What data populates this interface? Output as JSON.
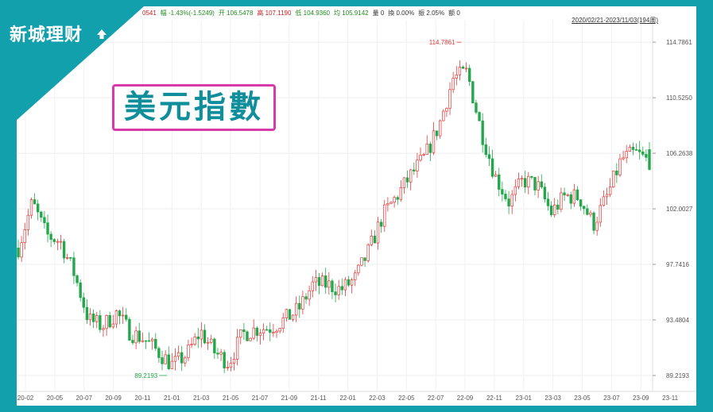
{
  "brand": {
    "name": "新城理财",
    "icon": "up-arrow-icon"
  },
  "title": "美元指數",
  "header": [
    {
      "text": "0541",
      "tone": "up"
    },
    {
      "text": "幅 -1.43%(-1.5249)",
      "tone": "dn"
    },
    {
      "text": "开 106.5478",
      "tone": "dn"
    },
    {
      "text": "高 107.1190",
      "tone": "up"
    },
    {
      "text": "低 104.9360",
      "tone": "dn"
    },
    {
      "text": "均 105.9142",
      "tone": "dn"
    },
    {
      "text": "量 0",
      "tone": ""
    },
    {
      "text": "換 0.00%",
      "tone": ""
    },
    {
      "text": "振 2.05%",
      "tone": ""
    },
    {
      "text": "额 0",
      "tone": ""
    }
  ],
  "range_label": "2020/02/21-2023/11/03(194周)",
  "colors": {
    "up": "#e03a3a",
    "down": "#22a84a",
    "frame": "#13a0ad",
    "title": "#0f8e9b",
    "title_border": "#d93aa9"
  },
  "chart_data": {
    "type": "candlestick",
    "title": "美元指數",
    "ylim": [
      88.0,
      116.5
    ],
    "grid": true,
    "y_ticks": [
      "114.7861",
      "110.5250",
      "106.2638",
      "102.0027",
      "97.7416",
      "93.4804",
      "89.2193"
    ],
    "x_ticks": [
      "20-02",
      "20-05",
      "20-07",
      "20-09",
      "20-11",
      "21-01",
      "21-03",
      "21-05",
      "21-07",
      "21-09",
      "21-11",
      "22-01",
      "22-03",
      "22-05",
      "22-07",
      "22-09",
      "22-11",
      "23-01",
      "23-03",
      "23-05",
      "23-07",
      "23-09",
      "23-11"
    ],
    "annotations": [
      {
        "text": "114.7861",
        "x": "2022-09-30",
        "y": 114.7861
      },
      {
        "text": "89.2193",
        "x": "2021-01-08",
        "y": 89.2193
      }
    ],
    "path_points": [
      [
        "2020-02",
        99.0
      ],
      [
        "2020-03",
        102.5
      ],
      [
        "2020-04",
        100.0
      ],
      [
        "2020-05",
        99.5
      ],
      [
        "2020-06",
        97.0
      ],
      [
        "2020-07",
        93.5
      ],
      [
        "2020-08",
        93.0
      ],
      [
        "2020-09",
        94.0
      ],
      [
        "2020-10",
        92.5
      ],
      [
        "2020-11",
        92.0
      ],
      [
        "2021-01",
        90.0
      ],
      [
        "2021-02",
        90.8
      ],
      [
        "2021-03",
        92.6
      ],
      [
        "2021-04",
        91.0
      ],
      [
        "2021-05",
        90.2
      ],
      [
        "2021-06",
        92.4
      ],
      [
        "2021-07",
        92.8
      ],
      [
        "2021-08",
        92.9
      ],
      [
        "2021-09",
        93.5
      ],
      [
        "2021-10",
        94.3
      ],
      [
        "2021-11",
        96.2
      ],
      [
        "2021-12",
        96.2
      ],
      [
        "2022-01",
        95.8
      ],
      [
        "2022-02",
        96.6
      ],
      [
        "2022-03",
        98.8
      ],
      [
        "2022-04",
        101.5
      ],
      [
        "2022-05",
        103.0
      ],
      [
        "2022-06",
        104.6
      ],
      [
        "2022-07",
        106.0
      ],
      [
        "2022-08",
        108.4
      ],
      [
        "2022-09",
        112.0
      ],
      [
        "2022-10",
        112.5
      ],
      [
        "2022-11",
        108.0
      ],
      [
        "2022-12",
        104.5
      ],
      [
        "2023-01",
        102.5
      ],
      [
        "2023-02",
        104.2
      ],
      [
        "2023-03",
        103.8
      ],
      [
        "2023-04",
        101.7
      ],
      [
        "2023-05",
        103.0
      ],
      [
        "2023-06",
        102.9
      ],
      [
        "2023-07",
        100.8
      ],
      [
        "2023-08",
        103.0
      ],
      [
        "2023-09",
        105.8
      ],
      [
        "2023-10",
        106.3
      ],
      [
        "2023-11",
        105.6
      ]
    ],
    "last_candle": {
      "open": 106.5478,
      "high": 107.119,
      "low": 104.936,
      "close": 105.0229
    }
  }
}
